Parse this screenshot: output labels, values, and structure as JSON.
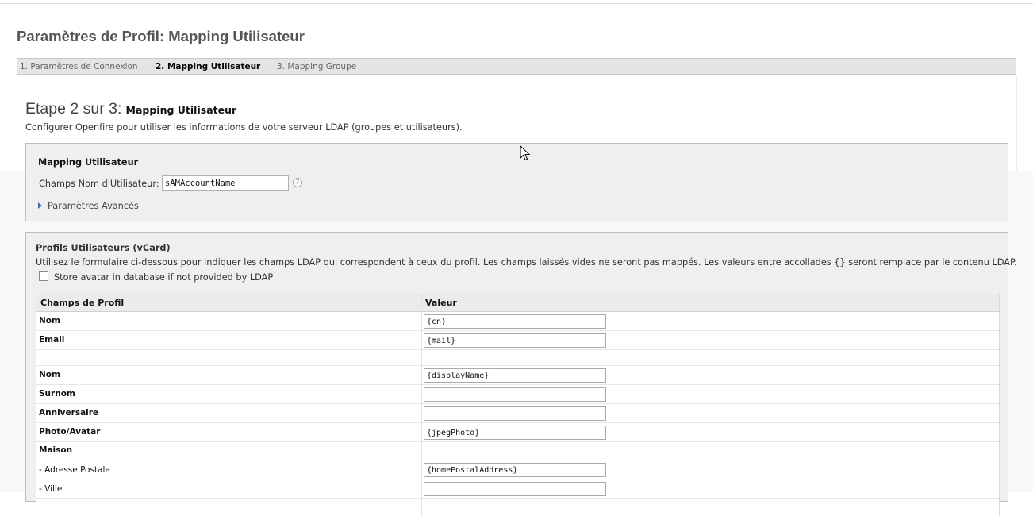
{
  "page": {
    "title": "Paramètres de Profil: Mapping Utilisateur"
  },
  "steps": [
    {
      "label": "1. Paramètres de Connexion"
    },
    {
      "label": "2. Mapping Utilisateur"
    },
    {
      "label": "3. Mapping Groupe"
    }
  ],
  "step_header": {
    "prefix": "Etape 2 sur 3:",
    "name": "Mapping Utilisateur",
    "description": "Configurer Openfire pour utiliser les informations de votre serveur LDAP (groupes et utilisateurs)."
  },
  "user_mapping": {
    "title": "Mapping Utilisateur",
    "username_label": "Champs Nom d'Utilisateur:",
    "username_value": "sAMAccountName",
    "help_icon": "?",
    "advanced_link": "Paramètres Avancés"
  },
  "vcard": {
    "title": "Profils Utilisateurs (vCard)",
    "description": "Utilisez le formulaire ci-dessous pour indiquer les champs LDAP qui correspondent à ceux du profil. Les champs laissés vides ne seront pas mappés. Les valeurs entre accollades {} seront remplace par le contenu LDAP.",
    "store_avatar_label": "Store avatar in database if not provided by LDAP",
    "store_avatar_checked": false,
    "col_field": "Champs de Profil",
    "col_value": "Valeur",
    "rows": [
      {
        "label": "Nom",
        "value": "{cn}"
      },
      {
        "label": "Email",
        "value": "{mail}"
      },
      {
        "label": "",
        "value": ""
      },
      {
        "label": "Nom",
        "value": "{displayName}"
      },
      {
        "label": "Surnom",
        "value": ""
      },
      {
        "label": "Anniversaire",
        "value": ""
      },
      {
        "label": "Photo/Avatar",
        "value": "{jpegPhoto}"
      },
      {
        "label": "Maison",
        "value": ""
      },
      {
        "label": "- Adresse Postale",
        "value": "{homePostalAddress}"
      },
      {
        "label": "- Ville",
        "value": ""
      }
    ]
  }
}
